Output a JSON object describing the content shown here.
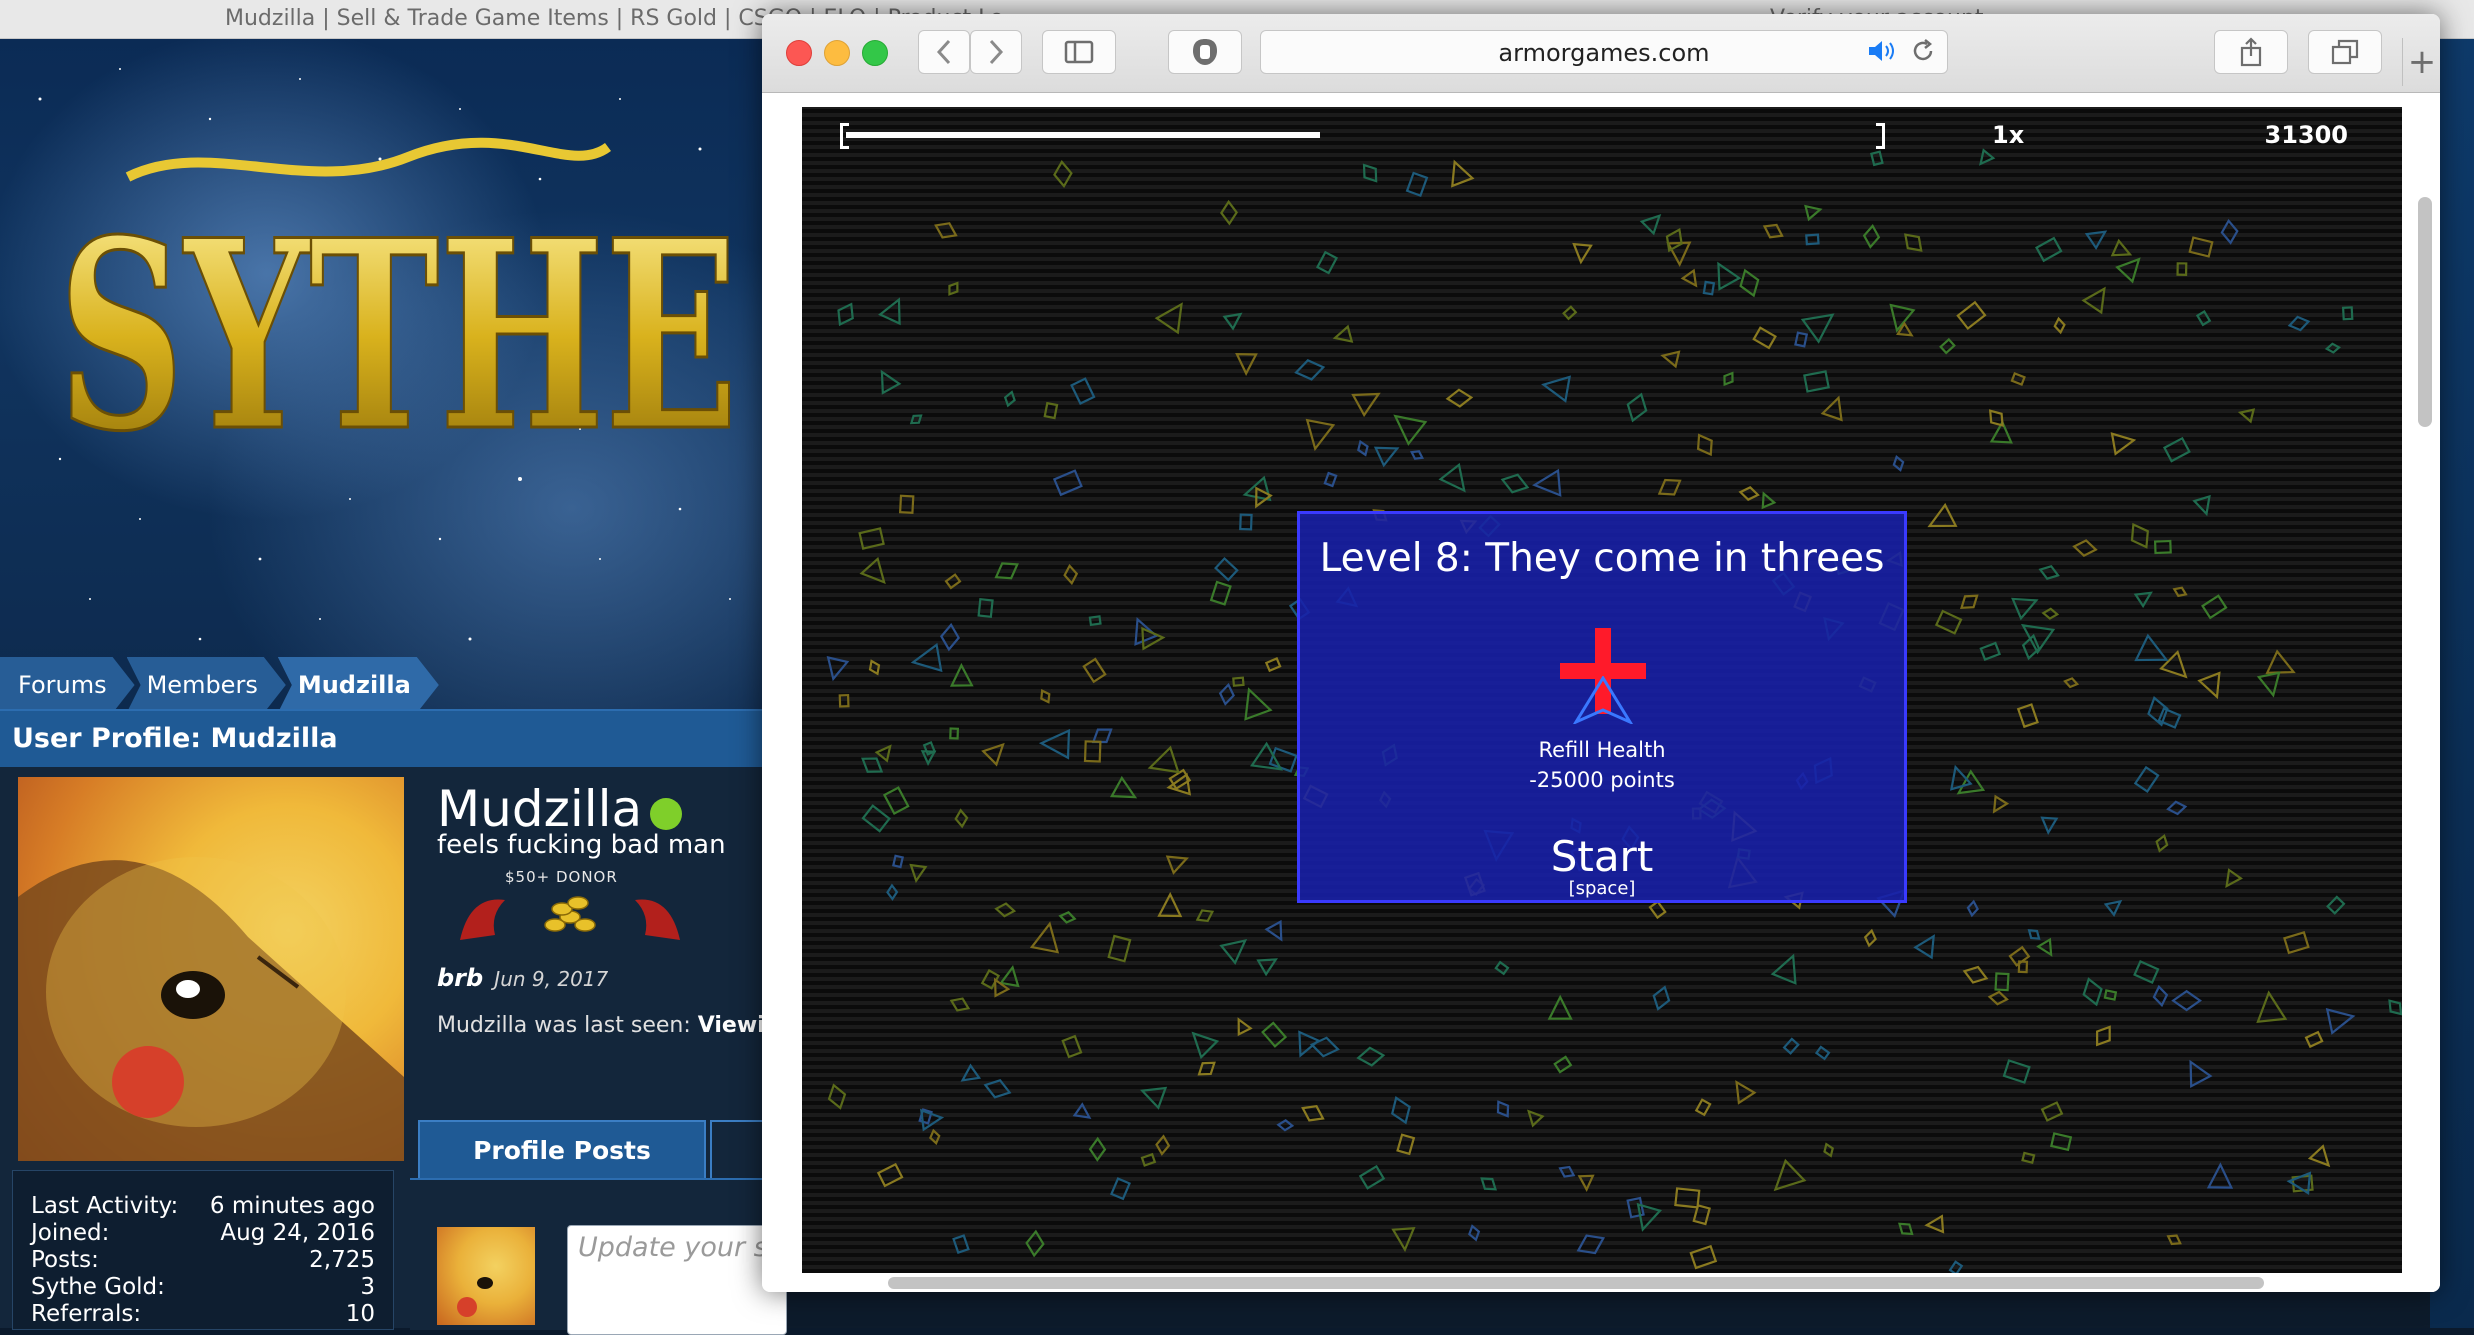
{
  "background_window": {
    "title_left": "Mudzilla | Sell & Trade Game Items | RS Gold | CSGO | ELO | Product Lo...",
    "title_right": "Verify your account",
    "breadcrumb": [
      "Forums",
      "Members",
      "Mudzilla"
    ],
    "profile_heading": "User Profile: Mudzilla",
    "username": "Mudzilla",
    "user_title": "feels fucking bad man",
    "donor_badge": "$50+ DONOR",
    "status_message": "brb",
    "status_date": "Jun 9, 2017",
    "last_seen_prefix": "Mudzilla was last seen:",
    "last_seen_value": "Viewi",
    "tab_profile_posts": "Profile Posts",
    "stats": [
      {
        "label": "Last Activity:",
        "value": "6 minutes ago"
      },
      {
        "label": "Joined:",
        "value": "Aug 24, 2016"
      },
      {
        "label": "Posts:",
        "value": "2,725"
      },
      {
        "label": "Sythe Gold:",
        "value": "3"
      },
      {
        "label": "Referrals:",
        "value": "10"
      }
    ],
    "update_placeholder": "Update your s",
    "logo_text": "SYTHE"
  },
  "browser": {
    "url": "armorgames.com",
    "icons": {
      "back": "chevron-left-icon",
      "forward": "chevron-right-icon",
      "sidebar": "sidebar-icon",
      "privacy": "hand-shield-icon",
      "audio": "speaker-icon",
      "reload": "reload-icon",
      "share": "share-icon",
      "tabs": "tabs-icon",
      "new_tab": "plus-icon"
    },
    "new_tab_symbol": "+"
  },
  "game": {
    "multiplier": "1x",
    "score": "31300",
    "health_fraction": 0.46,
    "level_title": "Level 8: They come in threes",
    "powerup_label": "Refill Health",
    "powerup_cost": "-25000 points",
    "start_label": "Start",
    "start_key": "[space]"
  },
  "colors": {
    "cross_red": "#ff1a2a",
    "panel_blue": "#1820aa",
    "online_green": "#7fcf2a",
    "breadcrumb_blue": "#275d96"
  }
}
